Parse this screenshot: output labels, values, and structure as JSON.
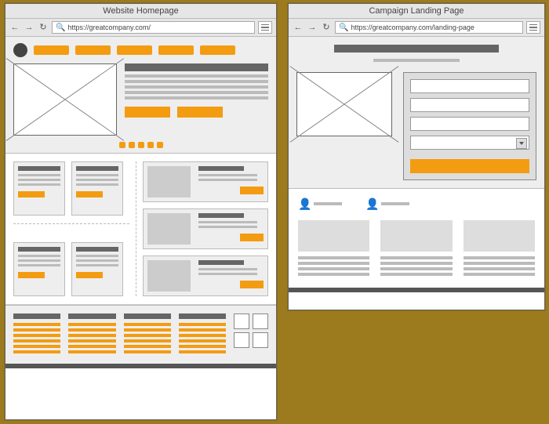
{
  "left": {
    "title": "Website Homepage",
    "url": "https://greatcompany.com/"
  },
  "right": {
    "title": "Campaign Landing Page",
    "url": "https://greatcompany.com/landing-page"
  }
}
